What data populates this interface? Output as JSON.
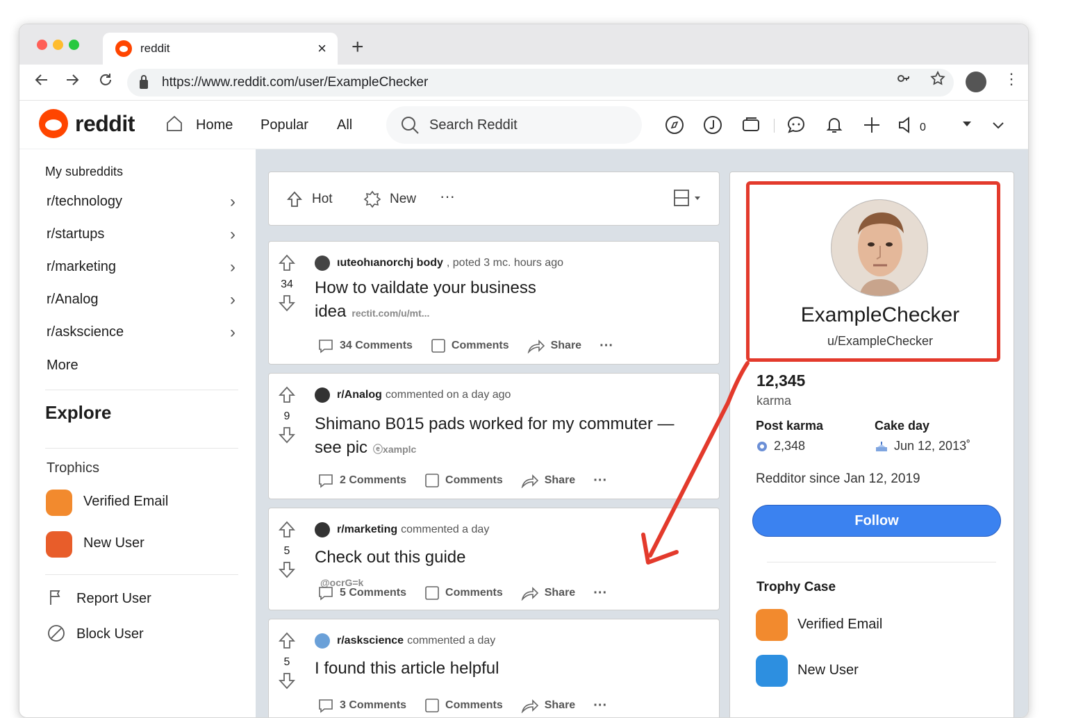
{
  "browser": {
    "tab_title": "reddit",
    "tab_close": "×",
    "new_tab": "+",
    "url": "https://www.reddit.com/user/ExampleChecker"
  },
  "header": {
    "logo": "reddit",
    "nav": [
      "Home",
      "Popular",
      "All"
    ],
    "search_placeholder": "Search Reddit",
    "badge_count": "0"
  },
  "left_nav": {
    "heading": "My subreddits",
    "subreddits": [
      "r/technology",
      "r/startups",
      "r/marketing",
      "r/Analog",
      "r/asksciencе"
    ],
    "more": "More",
    "explore": "Explore",
    "trophies_label": "Trophics",
    "trophies": [
      "Verified Email",
      "New User"
    ],
    "actions": [
      "Report User",
      "Block User"
    ]
  },
  "sort": {
    "hot": "Hot",
    "new": "New",
    "more": "···"
  },
  "posts": [
    {
      "votes": "34",
      "author": "ιuteohιanorchj body",
      "meta": ", poted 3 mc. hours ago",
      "title_line1": "How to vaildate your business",
      "title_line2": "idea",
      "link": "rectit.com/u/mt...",
      "comments": "34 Comments",
      "save": "Comments",
      "share": "Share",
      "more": "···"
    },
    {
      "votes": "9",
      "author": "r/Analog",
      "meta": "commented on a day ago",
      "title_line1": "Shimano B015 pads worked for my commuter —",
      "title_line2": "see pic",
      "link": "ⓔxamplc",
      "comments": "2 Comments",
      "save": "Comments",
      "share": "Share",
      "more": "···"
    },
    {
      "votes": "5",
      "author": "r/marketing",
      "meta": "commented a day",
      "title_line1": "Check out this guide",
      "title_line2": "",
      "link": "@ocrG=k",
      "comments": "5 Comments",
      "save": "Comments",
      "share": "Share",
      "more": "···"
    },
    {
      "votes": "5",
      "author": "r/askscience",
      "meta": "commented a day",
      "title_line1": "I found this article helpful",
      "title_line2": "",
      "link": "",
      "comments": "3 Comments",
      "save": "Comments",
      "share": "Share",
      "more": "···"
    }
  ],
  "profile": {
    "display_name": "ExampleChecker",
    "handle": "u/ExampleChecker",
    "karma": "12,345",
    "karma_label": "karma",
    "post_karma_label": "Post karma",
    "post_karma": "2,348",
    "cake_day_label": "Cake day",
    "cake_day": "Jun 12, 2013˚",
    "since": "Redditor since Jan 12,  2019",
    "follow": "Follow",
    "trophy_case": "Trophy Case",
    "trophies": [
      "Verified Email",
      "New User"
    ]
  },
  "colors": {
    "reddit_orange": "#ff4500",
    "highlight_red": "#e33a2c",
    "follow_blue": "#3b82f0",
    "feed_bg": "#dae0e6"
  }
}
